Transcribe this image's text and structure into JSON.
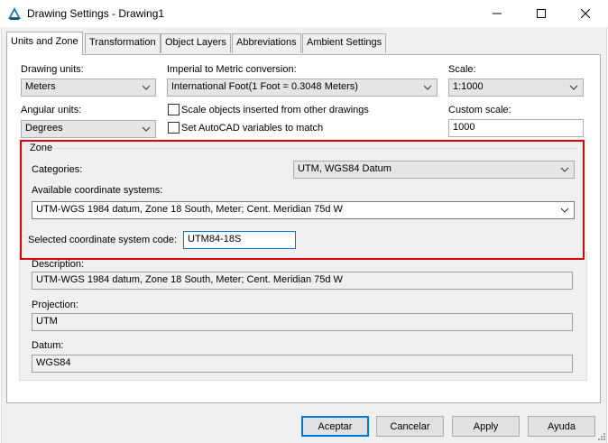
{
  "window": {
    "title": "Drawing Settings - Drawing1",
    "minimize_glyph": "—",
    "maximize_glyph": "☐",
    "close_glyph": "✕"
  },
  "tabs": [
    {
      "label": "Units and Zone",
      "active": true
    },
    {
      "label": "Transformation"
    },
    {
      "label": "Object Layers"
    },
    {
      "label": "Abbreviations"
    },
    {
      "label": "Ambient Settings"
    }
  ],
  "units": {
    "drawing_units_label": "Drawing units:",
    "drawing_units_value": "Meters",
    "angular_units_label": "Angular units:",
    "angular_units_value": "Degrees",
    "imperial_label": "Imperial to Metric conversion:",
    "imperial_value": "International Foot(1 Foot = 0.3048 Meters)",
    "scale_objects_label": "Scale objects inserted from other drawings",
    "set_vars_label": "Set AutoCAD variables to match",
    "scale_label": "Scale:",
    "scale_value": "1:1000",
    "custom_scale_label": "Custom scale:",
    "custom_scale_value": "1000"
  },
  "zone": {
    "legend": "Zone",
    "categories_label": "Categories:",
    "categories_value": "UTM, WGS84 Datum",
    "available_label": "Available coordinate systems:",
    "available_value": "UTM-WGS 1984 datum, Zone 18 South, Meter; Cent. Meridian 75d W",
    "selected_code_label": "Selected coordinate system code:",
    "selected_code_value": "UTM84-18S"
  },
  "details": {
    "description_label": "Description:",
    "description_value": "UTM-WGS 1984 datum, Zone 18 South, Meter; Cent. Meridian 75d W",
    "projection_label": "Projection:",
    "projection_value": "UTM",
    "datum_label": "Datum:",
    "datum_value": "WGS84"
  },
  "buttons": {
    "ok": "Aceptar",
    "cancel": "Cancelar",
    "apply": "Apply",
    "help": "Ayuda"
  },
  "colors": {
    "highlight_border": "#e00000",
    "ok_focus_border": "#0078d7"
  }
}
